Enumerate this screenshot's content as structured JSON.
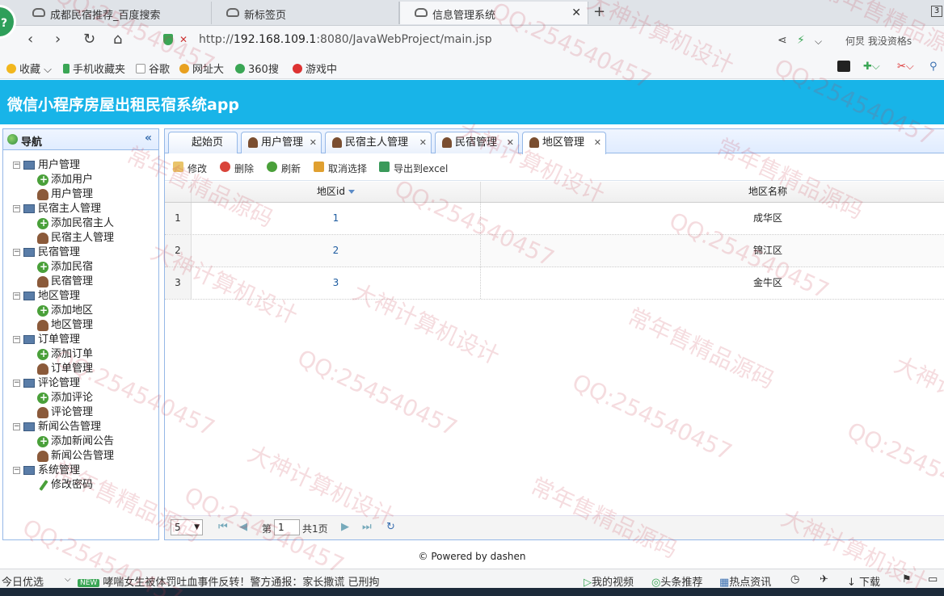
{
  "browser": {
    "tabs": [
      {
        "label": "成都民宿推荐_百度搜索"
      },
      {
        "label": "新标签页"
      },
      {
        "label": "信息管理系统"
      }
    ],
    "tab_count": "3",
    "url_prefix": "http://",
    "url_host": "192.168.109.1",
    "url_rest": ":8080/JavaWebProject/main.jsp",
    "user_text": "何炅 我没资格s",
    "bookmarks": [
      "收藏",
      "手机收藏夹",
      "谷歌",
      "网址大",
      "360搜",
      "游戏中"
    ]
  },
  "app": {
    "title": "微信小程序房屋出租民宿系统app"
  },
  "sidebar": {
    "title": "导航",
    "groups": [
      {
        "label": "用户管理",
        "children": [
          {
            "label": "添加用户",
            "icon": "add"
          },
          {
            "label": "用户管理",
            "icon": "user"
          }
        ]
      },
      {
        "label": "民宿主人管理",
        "children": [
          {
            "label": "添加民宿主人",
            "icon": "add"
          },
          {
            "label": "民宿主人管理",
            "icon": "user"
          }
        ]
      },
      {
        "label": "民宿管理",
        "children": [
          {
            "label": "添加民宿",
            "icon": "add"
          },
          {
            "label": "民宿管理",
            "icon": "user"
          }
        ]
      },
      {
        "label": "地区管理",
        "children": [
          {
            "label": "添加地区",
            "icon": "add"
          },
          {
            "label": "地区管理",
            "icon": "user",
            "selected": true
          }
        ]
      },
      {
        "label": "订单管理",
        "children": [
          {
            "label": "添加订单",
            "icon": "add"
          },
          {
            "label": "订单管理",
            "icon": "user"
          }
        ]
      },
      {
        "label": "评论管理",
        "children": [
          {
            "label": "添加评论",
            "icon": "add"
          },
          {
            "label": "评论管理",
            "icon": "user"
          }
        ]
      },
      {
        "label": "新闻公告管理",
        "children": [
          {
            "label": "添加新闻公告",
            "icon": "add"
          },
          {
            "label": "新闻公告管理",
            "icon": "user"
          }
        ]
      },
      {
        "label": "系统管理",
        "children": [
          {
            "label": "修改密码",
            "icon": "pen"
          }
        ]
      }
    ]
  },
  "main": {
    "tabs": [
      {
        "label": "起始页",
        "closable": false
      },
      {
        "label": "用户管理",
        "closable": true
      },
      {
        "label": "民宿主人管理",
        "closable": true
      },
      {
        "label": "民宿管理",
        "closable": true
      },
      {
        "label": "地区管理",
        "closable": true,
        "active": true
      }
    ],
    "toolbar": {
      "edit": "修改",
      "delete": "删除",
      "refresh": "刷新",
      "unselect": "取消选择",
      "export": "导出到excel"
    },
    "columns": {
      "id": "地区id",
      "name": "地区名称"
    },
    "rows": [
      {
        "num": "1",
        "id": "1",
        "name": "成华区"
      },
      {
        "num": "2",
        "id": "2",
        "name": "锦江区"
      },
      {
        "num": "3",
        "id": "3",
        "name": "金牛区"
      }
    ],
    "pager": {
      "page_size": "5",
      "page_prefix": "第",
      "page_value": "1",
      "page_total": "共1页"
    }
  },
  "footer": {
    "text": "© Powered by dashen"
  },
  "statusbar": {
    "left": "今日优选",
    "news": "哮喘女生被体罚吐血事件反转！警方通报：家长撒谎 已刑拘",
    "new_badge": "NEW",
    "video": "我的视频",
    "headline": "头条推荐",
    "hot": "热点资讯",
    "download": "下载"
  },
  "watermarks": [
    "QQ:254540457",
    "常年售精品源码",
    "大神计算机设计"
  ]
}
